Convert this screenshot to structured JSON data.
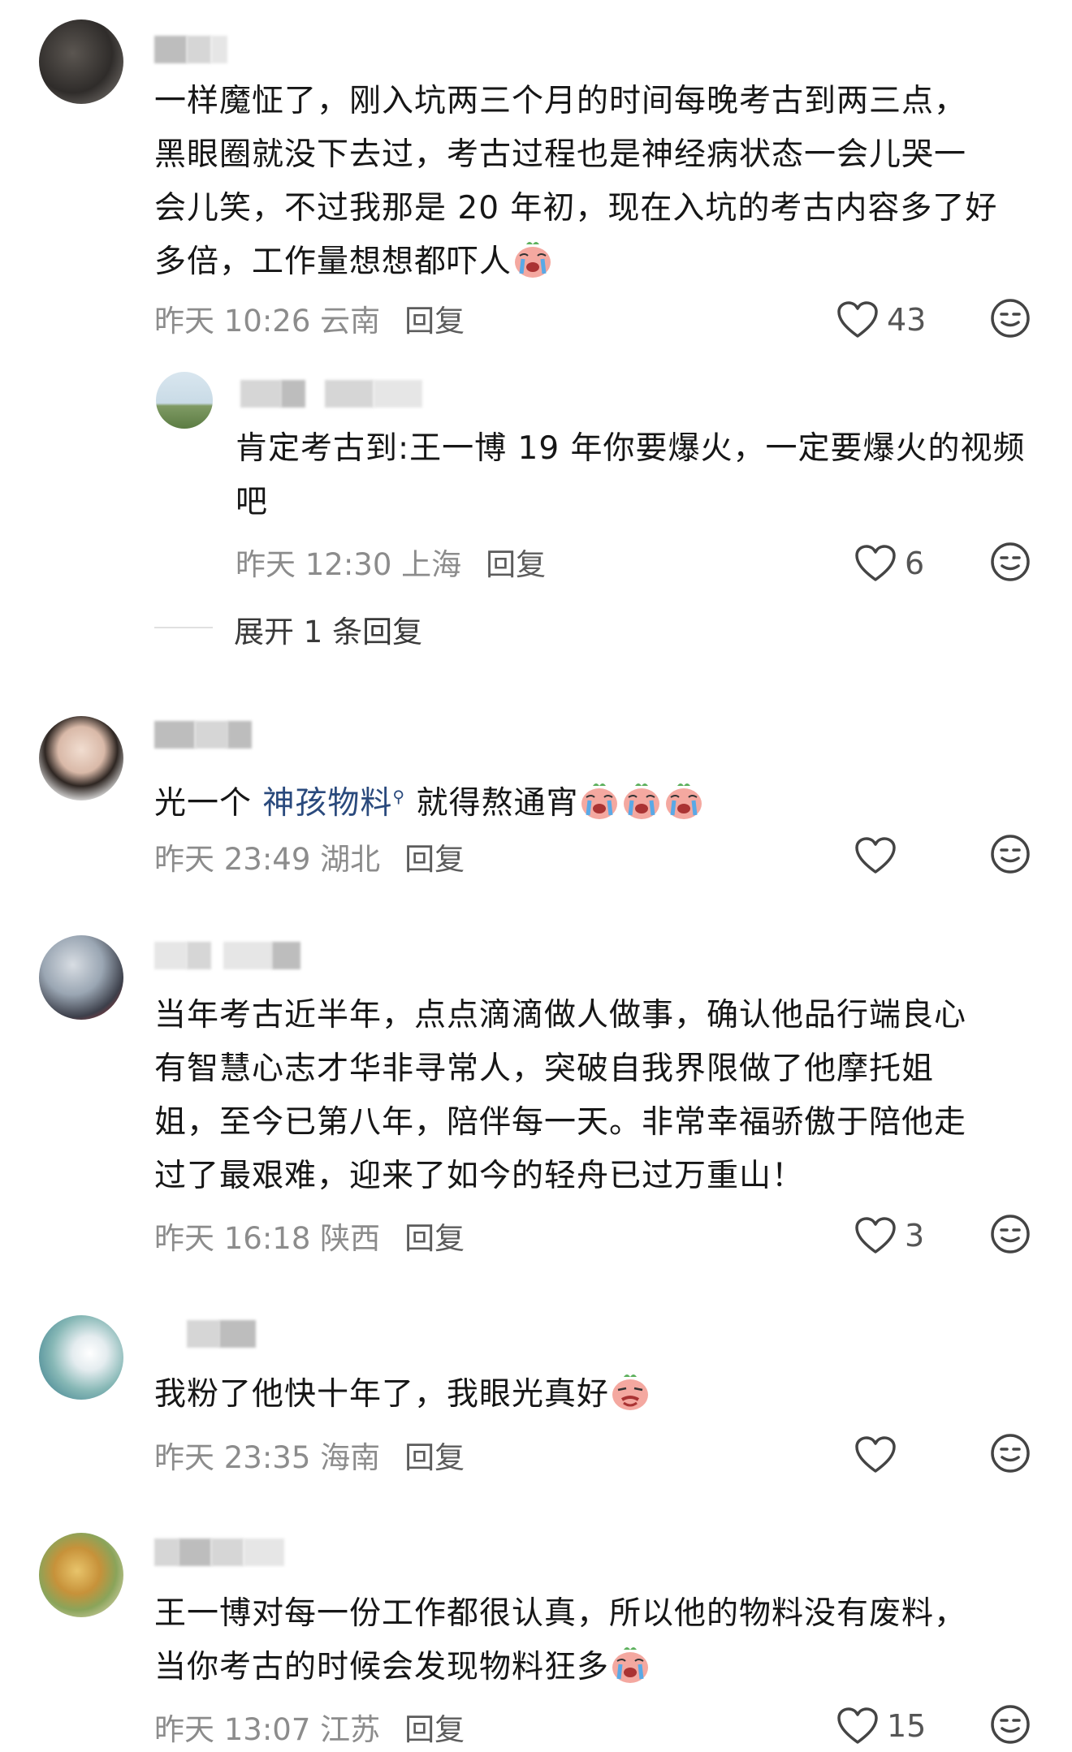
{
  "comments": [
    {
      "text": "一样魔怔了，刚入坑两三个月的时间每晚考古到两三点，黑眼圈就没下去过，考古过程也是神经病状态一会儿哭一会儿笑，不过我那是20年初，现在入坑的考古内容多了好多倍，工作量想想都吓人",
      "lines": [
        "一样魔怔了，刚入坑两三个月的时间每晚考古到两三点，",
        "黑眼圈就没下去过，考古过程也是神经病状态一会儿哭一",
        "会儿笑，不过我那是 20 年初，现在入坑的考古内容多了好",
        "多倍，工作量想想都吓人"
      ],
      "time": "昨天 10:26 云南",
      "reply_label": "回复",
      "likes": "43",
      "emojis": [
        "crying-face-emoji"
      ]
    },
    {
      "text": "肯定考古到:王一博19年你要爆火，一定要爆火的视频吧",
      "lines": [
        "肯定考古到:王一博 19 年你要爆火，一定要爆火的视频",
        "吧"
      ],
      "time": "昨天 12:30 上海",
      "reply_label": "回复",
      "likes": "6"
    },
    {
      "expand_label": "展开 1 条回复"
    },
    {
      "text_before": "光一个 ",
      "highlight": "神孩物料",
      "text_after": " 就得熬通宵",
      "time": "昨天 23:49 湖北",
      "reply_label": "回复",
      "likes": "",
      "emojis": [
        "crying-face-emoji",
        "crying-face-emoji",
        "crying-face-emoji"
      ]
    },
    {
      "text": "当年考古近半年，点点滴滴做人做事，确认他品行端良心有智慧心志才华非寻常人，突破自我界限做了他摩托姐姐，至今已第八年，陪伴每一天。非常幸福骄傲于陪他走过了最艰难，迎来了如今的轻舟已过万重山！",
      "lines": [
        "当年考古近半年，点点滴滴做人做事，确认他品行端良心",
        "有智慧心志才华非寻常人，突破自我界限做了他摩托姐",
        "姐，至今已第八年，陪伴每一天。非常幸福骄傲于陪他走",
        "过了最艰难，迎来了如今的轻舟已过万重山！"
      ],
      "time": "昨天 16:18 陕西",
      "reply_label": "回复",
      "likes": "3"
    },
    {
      "text": "我粉了他快十年了，我眼光真好",
      "time": "昨天 23:35 海南",
      "reply_label": "回复",
      "likes": "",
      "emojis": [
        "smug-face-emoji"
      ]
    },
    {
      "text": "王一博对每一份工作都很认真，所以他的物料没有废料，当你考古的时候会发现物料狂多",
      "lines": [
        "王一博对每一份工作都很认真，所以他的物料没有废料，",
        "当你考古的时候会发现物料狂多"
      ],
      "time": "昨天 13:07 江苏",
      "reply_label": "回复",
      "likes": "15",
      "emojis": [
        "crying-face-emoji"
      ]
    }
  ],
  "colors": {
    "text": "#161616",
    "meta": "#8c8c8c",
    "highlight": "#2a4a7d",
    "icon": "#444444"
  }
}
